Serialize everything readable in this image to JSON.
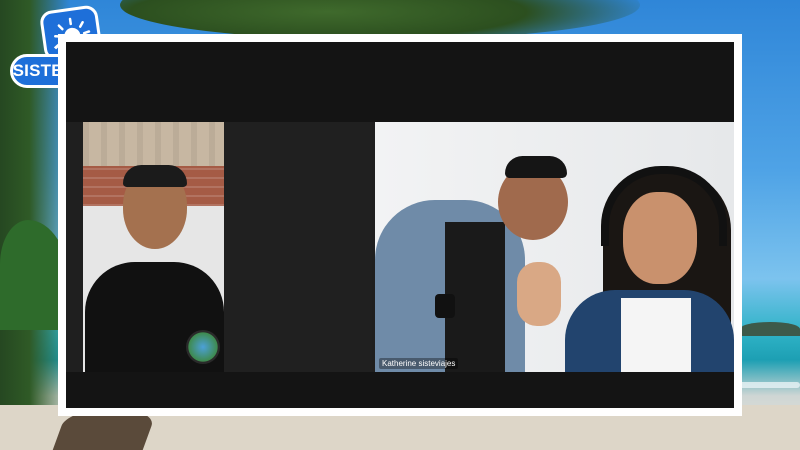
{
  "brand": {
    "logo_text": "SISTE VIAJES",
    "logo_icon": "sun-wave-icon",
    "color": "#1e6fd9"
  },
  "call": {
    "participants": [
      {
        "name": "",
        "role": "video-tile"
      },
      {
        "name": "Katherine sisteviajes",
        "role": "video-tile"
      }
    ]
  },
  "colors": {
    "frame": "#ffffff",
    "call_background": "#1f1f1f"
  }
}
